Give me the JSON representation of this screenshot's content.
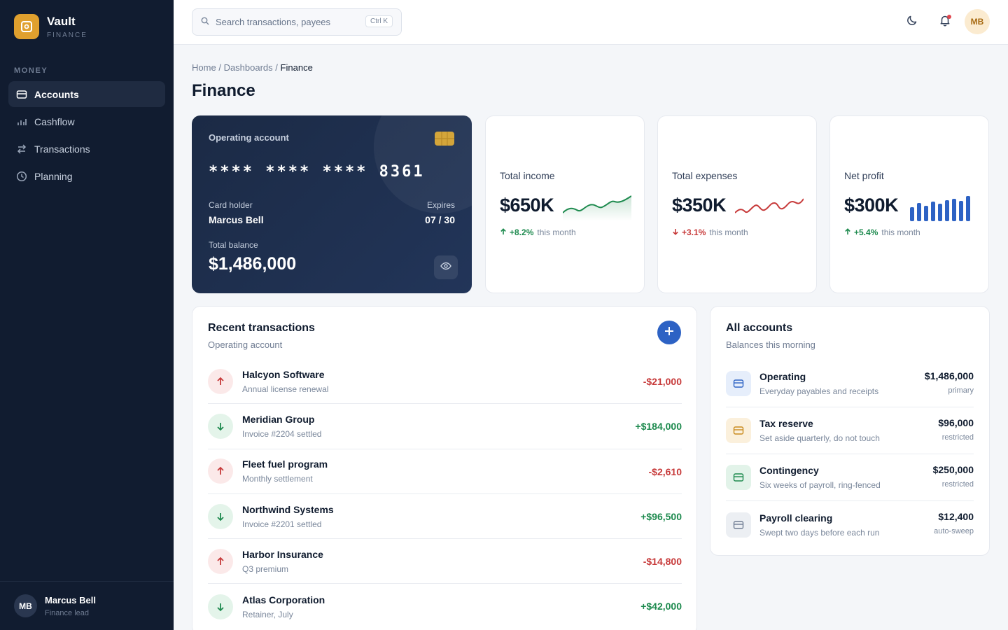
{
  "brand": {
    "name": "Vault",
    "sub": "FINANCE",
    "logo_color": "#e0a02e"
  },
  "sidebar": {
    "section": "MONEY",
    "items": [
      {
        "label": "Accounts",
        "icon": "card-icon",
        "active": true
      },
      {
        "label": "Cashflow",
        "icon": "bar-chart-icon",
        "active": false
      },
      {
        "label": "Transactions",
        "icon": "swap-icon",
        "active": false
      },
      {
        "label": "Planning",
        "icon": "clock-icon",
        "active": false
      }
    ],
    "user": {
      "initials": "MB",
      "name": "Marcus Bell",
      "role": "Finance lead"
    }
  },
  "topbar": {
    "search_placeholder": "Search transactions, payees",
    "shortcut": "Ctrl K",
    "avatar_initials": "MB"
  },
  "breadcrumb": {
    "home": "Home",
    "dashboards": "Dashboards",
    "current": "Finance",
    "sep": "/"
  },
  "page_title": "Finance",
  "account_card": {
    "label": "Operating account",
    "number": "**** **** **** 8361",
    "holder_label": "Card holder",
    "holder_name": "Marcus Bell",
    "expires_label": "Expires",
    "expires": "07 / 30",
    "balance_label": "Total balance",
    "balance": "$1,486,000"
  },
  "stats": [
    {
      "label": "Total income",
      "value": "$650K",
      "delta": "+8.2%",
      "delta_suffix": "this month",
      "trend": "up",
      "chart": "area-line",
      "color": "#1d8a4e"
    },
    {
      "label": "Total expenses",
      "value": "$350K",
      "delta": "+3.1%",
      "delta_suffix": "this month",
      "trend": "down",
      "chart": "line",
      "color": "#c73a3a"
    },
    {
      "label": "Net profit",
      "value": "$300K",
      "delta": "+5.4%",
      "delta_suffix": "this month",
      "trend": "up",
      "chart": "bars",
      "color": "#2d62c4"
    }
  ],
  "transactions": {
    "title": "Recent transactions",
    "subtitle": "Operating account",
    "items": [
      {
        "name": "Halcyon Software",
        "desc": "Annual license renewal",
        "amount": "-$21,000",
        "dir": "out"
      },
      {
        "name": "Meridian Group",
        "desc": "Invoice #2204 settled",
        "amount": "+$184,000",
        "dir": "in"
      },
      {
        "name": "Fleet fuel program",
        "desc": "Monthly settlement",
        "amount": "-$2,610",
        "dir": "out"
      },
      {
        "name": "Northwind Systems",
        "desc": "Invoice #2201 settled",
        "amount": "+$96,500",
        "dir": "in"
      },
      {
        "name": "Harbor Insurance",
        "desc": "Q3 premium",
        "amount": "-$14,800",
        "dir": "out"
      },
      {
        "name": "Atlas Corporation",
        "desc": "Retainer, July",
        "amount": "+$42,000",
        "dir": "in"
      }
    ]
  },
  "accounts": {
    "title": "All accounts",
    "subtitle": "Balances this morning",
    "items": [
      {
        "name": "Operating",
        "desc": "Everyday payables and receipts",
        "balance": "$1,486,000",
        "tag": "primary",
        "color": "#2d62c4",
        "bg": "#e6eefb"
      },
      {
        "name": "Tax reserve",
        "desc": "Set aside quarterly, do not touch",
        "balance": "$96,000",
        "tag": "restricted",
        "color": "#c98a1d",
        "bg": "#fbf0dc"
      },
      {
        "name": "Contingency",
        "desc": "Six weeks of payroll, ring-fenced",
        "balance": "$250,000",
        "tag": "restricted",
        "color": "#1d8a4e",
        "bg": "#e2f3e9"
      },
      {
        "name": "Payroll clearing",
        "desc": "Swept two days before each run",
        "balance": "$12,400",
        "tag": "auto-sweep",
        "color": "#6f7c92",
        "bg": "#eceff3"
      }
    ]
  }
}
